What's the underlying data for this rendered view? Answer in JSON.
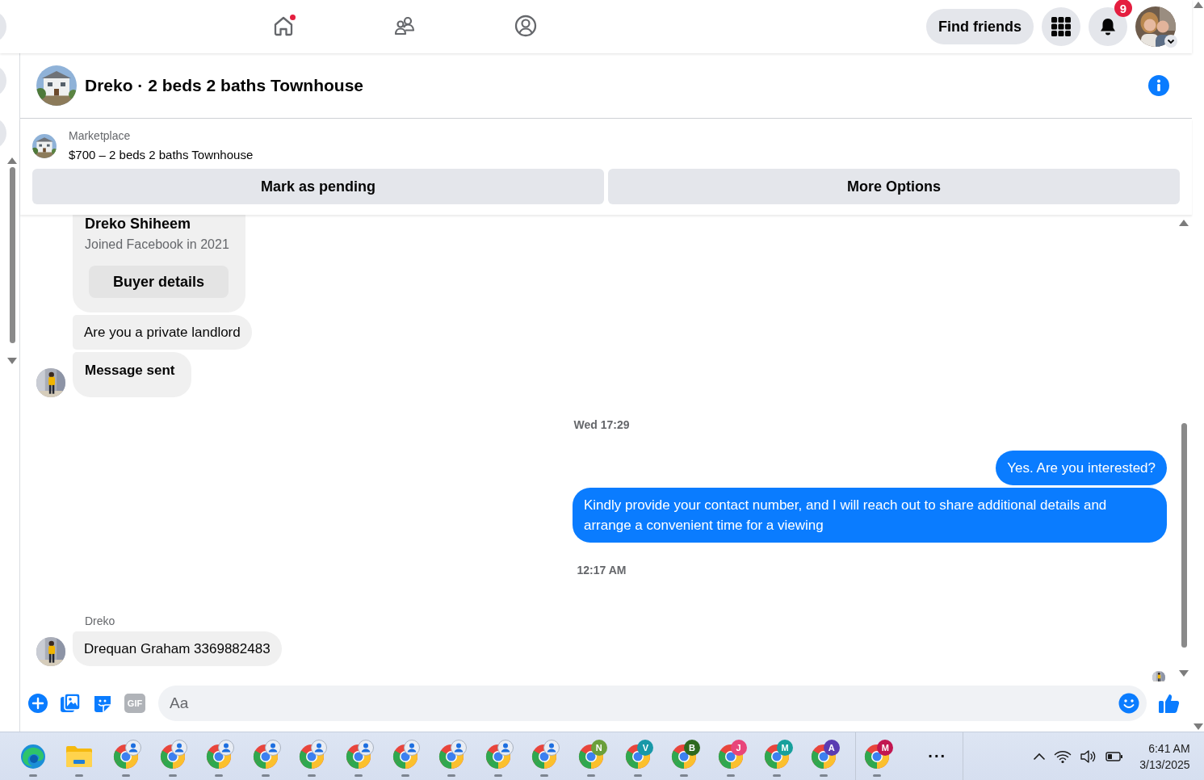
{
  "nav": {
    "tabs": [
      {
        "kind": "home",
        "selected": false,
        "notification": true
      },
      {
        "kind": "friends",
        "selected": false,
        "notification": false
      },
      {
        "kind": "profile",
        "selected": false,
        "notification": false
      }
    ],
    "find_friends": "Find friends",
    "notification_count": "9"
  },
  "conversation": {
    "title": "Dreko · 2 beds 2 baths Townhouse",
    "listing": {
      "label": "Marketplace",
      "title": "$700 – 2 beds 2 baths Townhouse",
      "actions": [
        "Mark as pending",
        "More Options"
      ]
    },
    "messages": [
      {
        "kind": "card",
        "name": "Dreko Shiheem",
        "subtitle": "Joined Facebook in 2021",
        "button": "Buyer details"
      },
      {
        "kind": "incoming",
        "text": "Are you a private landlord",
        "bold": false,
        "avatar": false
      },
      {
        "kind": "incoming",
        "text": "Message sent",
        "bold": true,
        "avatar": true
      },
      {
        "kind": "timestamp",
        "text": "Wed 17:29"
      },
      {
        "kind": "outgoing",
        "text": "Yes. Are you interested?"
      },
      {
        "kind": "outgoing",
        "text": "Kindly provide your contact number, and I will reach out to share additional details and arrange a convenient time for a viewing"
      },
      {
        "kind": "timestamp",
        "text": "12:17 AM"
      },
      {
        "kind": "incoming",
        "sender": "Dreko",
        "text": "Drequan Graham 3369882483",
        "bold": false,
        "avatar": true
      }
    ],
    "seen": true,
    "composer": {
      "gif_label": "GIF",
      "placeholder": "Aa"
    }
  },
  "taskbar": {
    "apps": [
      {
        "kind": "edge"
      },
      {
        "kind": "folder"
      },
      {
        "kind": "chrome_person"
      },
      {
        "kind": "chrome_person"
      },
      {
        "kind": "chrome_person"
      },
      {
        "kind": "chrome_person"
      },
      {
        "kind": "chrome_person"
      },
      {
        "kind": "chrome_person"
      },
      {
        "kind": "chrome_person"
      },
      {
        "kind": "chrome_person"
      },
      {
        "kind": "chrome_person"
      },
      {
        "kind": "chrome_person"
      },
      {
        "kind": "chrome_letter",
        "badge": "N",
        "color": "#6a9f3b"
      },
      {
        "kind": "chrome_letter",
        "badge": "V",
        "color": "#1898a8"
      },
      {
        "kind": "chrome_letter",
        "badge": "B",
        "color": "#2e6a1e"
      },
      {
        "kind": "chrome_letter",
        "badge": "J",
        "color": "#e8457a"
      },
      {
        "kind": "chrome_letter",
        "badge": "M",
        "color": "#17a09c"
      },
      {
        "kind": "chrome_letter",
        "badge": "A",
        "color": "#5a3bb2"
      }
    ],
    "overflow_apps": [
      {
        "kind": "chrome_letter",
        "badge": "M",
        "color": "#c21650"
      }
    ],
    "more": "···",
    "time": "6:41 AM",
    "date": "3/13/2025"
  }
}
